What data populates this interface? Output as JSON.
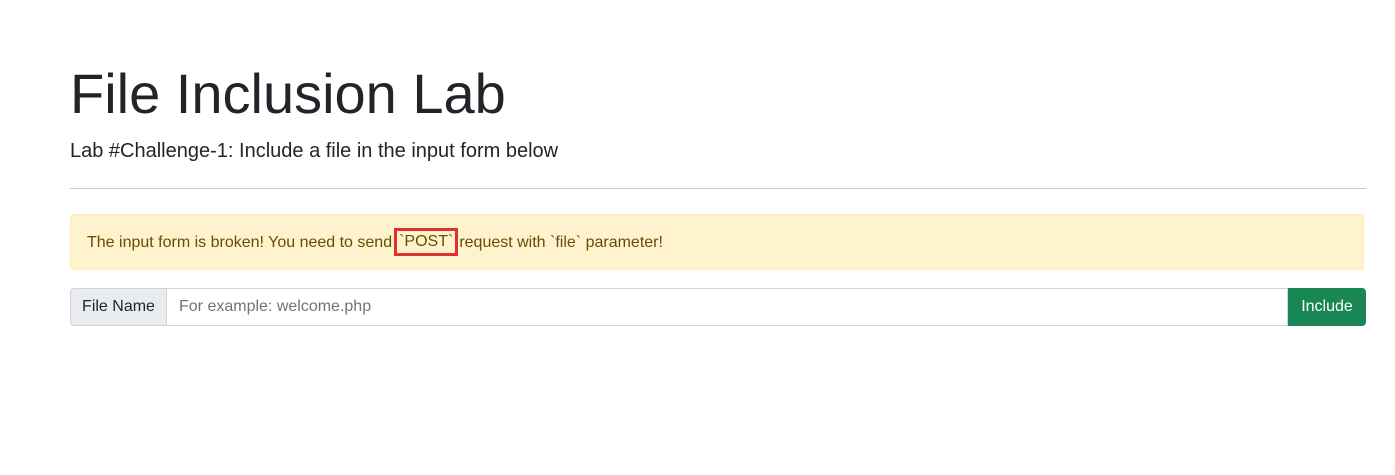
{
  "page": {
    "title": "File Inclusion Lab",
    "subtitle": "Lab #Challenge-1: Include a file in the input form below"
  },
  "alert": {
    "text_before": "The input form is broken! You need to send",
    "highlight": "`POST`",
    "text_after": "request with `file` parameter!"
  },
  "form": {
    "label": "File Name",
    "placeholder": "For example: welcome.php",
    "value": "",
    "button_label": "Include"
  },
  "colors": {
    "alert_bg": "#fff3cd",
    "alert_text": "#664d03",
    "button_bg": "#198754",
    "highlight_border": "#e03131"
  }
}
